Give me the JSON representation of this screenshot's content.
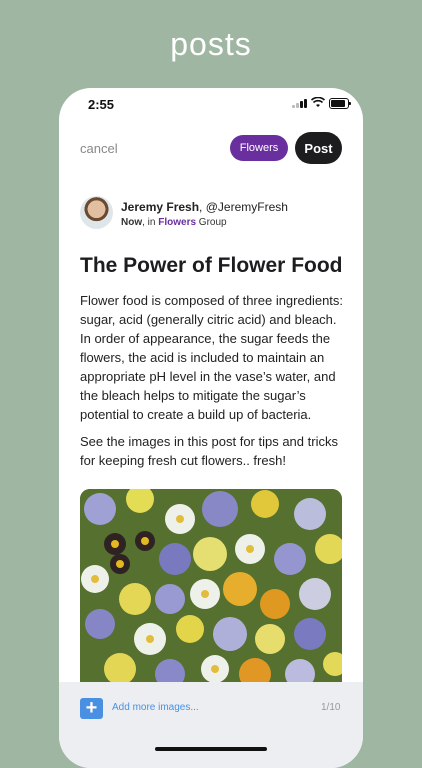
{
  "caption": "posts",
  "status_bar": {
    "time": "2:55"
  },
  "header": {
    "cancel_label": "cancel",
    "group_label": "Flowers",
    "post_label": "Post"
  },
  "author": {
    "name": "Jeremy Fresh",
    "handle": ", @JeremyFresh",
    "when": "Now",
    "in_text": ", in ",
    "group": "Flowers",
    "group_suffix": " Group"
  },
  "post": {
    "title": "The Power of Flower Food",
    "paragraph_1": "Flower food is composed of three ingredients: sugar, acid (generally citric acid) and bleach. In order of appearance, the sugar feeds the flowers, the acid is included to maintain an appropriate pH level in the vase’s water, and the bleach helps to mitigate the sugar’s potential to create a build up of bacteria.",
    "paragraph_2": "See the images in this post for tips and tricks for keeping fresh cut flowers.. fresh!"
  },
  "footer": {
    "add_button_icon": "plus-icon",
    "add_more_label": "Add more images...",
    "image_counter": "1/10"
  },
  "colors": {
    "background": "#9fb6a3",
    "accent_purple": "#6a2f9f",
    "post_button": "#1d1d1f",
    "link_blue": "#4a90e2"
  }
}
